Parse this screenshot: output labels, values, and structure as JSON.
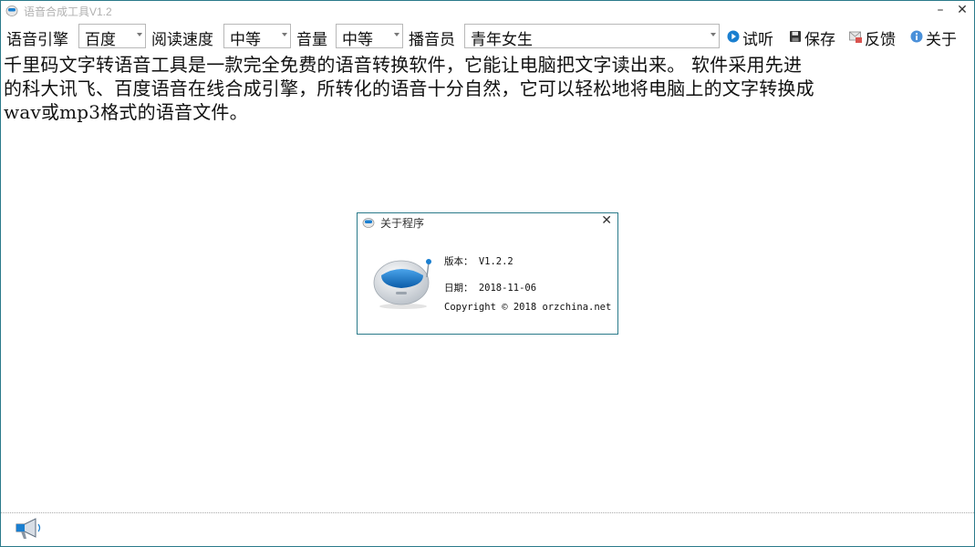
{
  "window": {
    "title": "语音合成工具V1.2",
    "minimize_glyph": "–",
    "close_glyph": "✕"
  },
  "toolbar": {
    "engine_label": "语音引擎",
    "engine_value": "百度",
    "speed_label": "阅读速度",
    "speed_value": "中等",
    "volume_label": "音量",
    "volume_value": "中等",
    "voice_label": "播音员",
    "voice_value": "青年女生",
    "preview_label": "试听",
    "save_label": "保存",
    "feedback_label": "反馈",
    "about_label": "关于"
  },
  "editor": {
    "lines": [
      "千里码文字转语音工具是一款完全免费的语音转换软件，它能让电脑把文字读出来。 软件采用先进",
      "的科大讯飞、百度语音在线合成引擎，所转化的语音十分自然，它可以轻松地将电脑上的文字转换成",
      "wav或mp3格式的语音文件。"
    ]
  },
  "about_dialog": {
    "title": "关于程序",
    "close_glyph": "✕",
    "version": "版本： V1.2.2",
    "date": "日期： 2018-11-06",
    "copyright": "Copyright © 2018 orzchina.net"
  },
  "icons": {
    "app": "speaker-robot-icon",
    "preview": "play-circle-icon",
    "save": "floppy-disk-icon",
    "feedback": "feedback-envelope-icon",
    "about": "info-circle-icon",
    "status": "megaphone-icon"
  },
  "colors": {
    "accent_blue": "#1a7fd0",
    "window_border": "#2a7a8a"
  }
}
